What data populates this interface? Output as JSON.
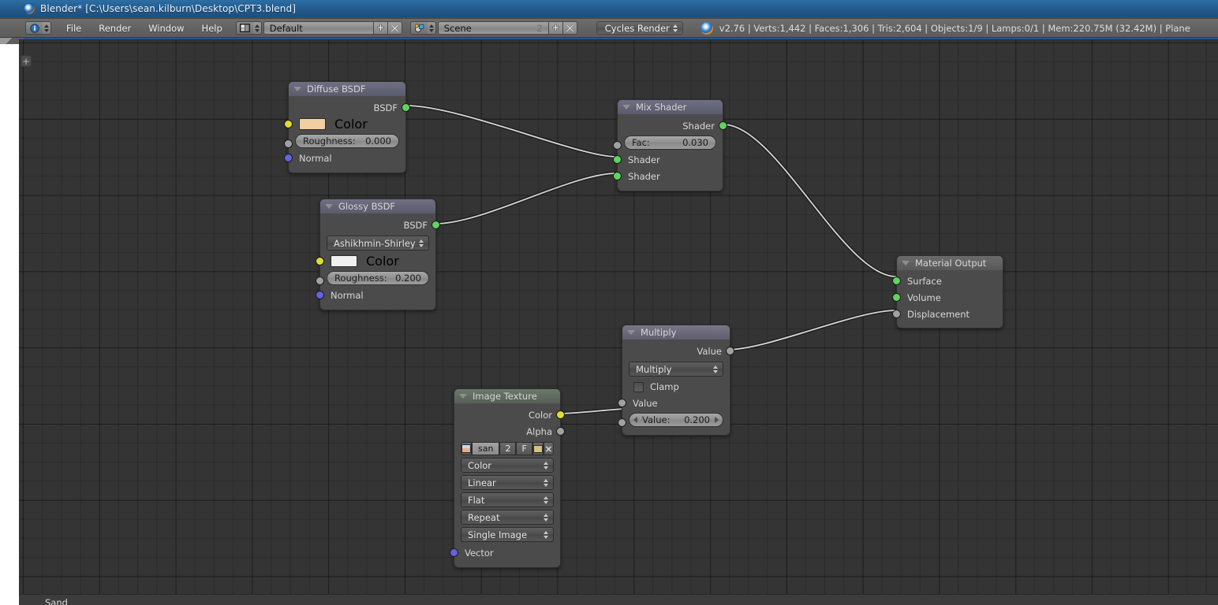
{
  "window": {
    "title": "Blender* [C:\\Users\\sean.kilburn\\Desktop\\CPT3.blend]",
    "app_icon": "blender-logo-icon"
  },
  "header": {
    "editor_type_icon": "info-editor-icon",
    "menus": [
      "File",
      "Render",
      "Window",
      "Help"
    ],
    "screen_layout": {
      "icon": "screen-layout-icon",
      "value": "Default",
      "add_label": "+",
      "delete_label": "×"
    },
    "scene": {
      "icon": "scene-icon",
      "value": "Scene",
      "users_count": "2",
      "add_label": "+",
      "delete_label": "×"
    },
    "render_engine": {
      "value": "Cycles Render"
    },
    "status": {
      "icon": "blender-logo-icon",
      "text": "v2.76 | Verts:1,442 | Faces:1,306 | Tris:2,604 | Objects:1/9 | Lamps:0/1 | Mem:220.75M (32.42M) | Plane"
    }
  },
  "canvas": {
    "toggle_label": "+",
    "footer_text": "Sand"
  },
  "colors": {
    "socket_shader": "#5fd35f",
    "socket_value": "#a1a1a1",
    "socket_color": "#dede32",
    "socket_vector": "#6363e0",
    "link": "#d6d6d6",
    "node_body": "#4b4b4b",
    "canvas_bg": "#343434"
  },
  "nodes": {
    "diffuse": {
      "title": "Diffuse BSDF",
      "outputs": [
        {
          "label": "BSDF",
          "type": "shader"
        }
      ],
      "color_label": "Color",
      "color_value": "#f2cfa0",
      "roughness_label": "Roughness:",
      "roughness_value": "0.000",
      "normal_label": "Normal"
    },
    "glossy": {
      "title": "Glossy BSDF",
      "outputs": [
        {
          "label": "BSDF",
          "type": "shader"
        }
      ],
      "distribution": "Ashikhmin-Shirley",
      "color_label": "Color",
      "color_value": "#f0f0f0",
      "roughness_label": "Roughness:",
      "roughness_value": "0.200",
      "normal_label": "Normal"
    },
    "mix_shader": {
      "title": "Mix Shader",
      "output_label": "Shader",
      "fac_label": "Fac:",
      "fac_value": "0.030",
      "input1_label": "Shader",
      "input2_label": "Shader"
    },
    "material_output": {
      "title": "Material Output",
      "surface_label": "Surface",
      "volume_label": "Volume",
      "displacement_label": "Displacement"
    },
    "multiply": {
      "title": "Multiply",
      "output_label": "Value",
      "operation": "Multiply",
      "clamp_label": "Clamp",
      "value_in_label": "Value",
      "value_label": "Value:",
      "value_value": "0.200"
    },
    "image_texture": {
      "title": "Image Texture",
      "out_color_label": "Color",
      "out_alpha_label": "Alpha",
      "datablock": {
        "thumb_icon": "image-thumbnail-icon",
        "name": "san",
        "users": "2",
        "fake_user": "F",
        "open_icon": "open-folder-icon",
        "unlink_icon": "unlink-x-icon"
      },
      "color_space": "Color",
      "interpolation": "Linear",
      "projection": "Flat",
      "extension": "Repeat",
      "source": "Single Image",
      "vector_label": "Vector"
    }
  }
}
